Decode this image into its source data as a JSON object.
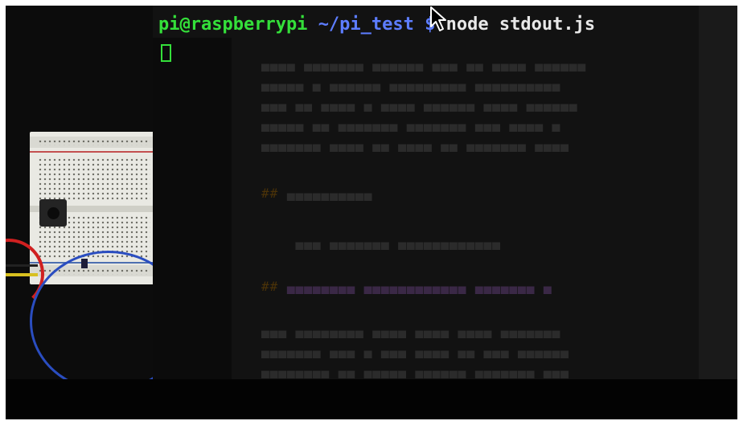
{
  "terminal": {
    "prompt_user_host": "pi@raspberrypi",
    "prompt_path": "~/pi_test",
    "prompt_symbol": "$",
    "command": "node stdout.js"
  },
  "colors": {
    "prompt_green": "#34e03a",
    "prompt_blue": "#5d7dff",
    "terminal_bg": "#121212"
  },
  "icons": {
    "cursor": "block-cursor",
    "pointer": "mouse-pointer-arrow"
  }
}
